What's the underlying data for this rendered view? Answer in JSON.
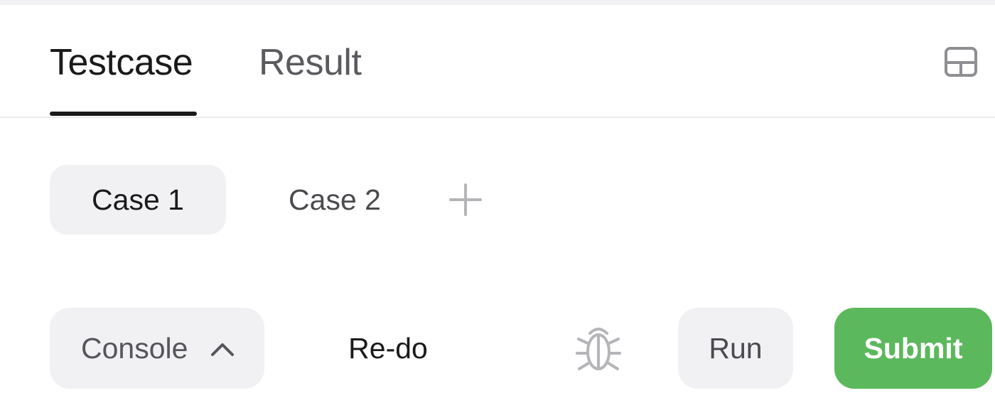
{
  "tabs": {
    "testcase_label": "Testcase",
    "result_label": "Result",
    "active": "Testcase",
    "layout_icon": "layout-panel-icon"
  },
  "cases": {
    "items": [
      "Case 1",
      "Case 2"
    ],
    "selected": "Case 1",
    "add_icon": "plus-icon"
  },
  "actions": {
    "console_label": "Console",
    "console_icon": "chevron-up-icon",
    "redo_label": "Re-do",
    "debug_icon": "bug-icon",
    "run_label": "Run",
    "submit_label": "Submit"
  },
  "colors": {
    "submit_bg": "#5cb85c",
    "pill_bg": "#f1f1f4",
    "active_text": "#1a1a1a",
    "muted_text": "#5a5a5f",
    "icon_gray": "#b5b5b9"
  }
}
